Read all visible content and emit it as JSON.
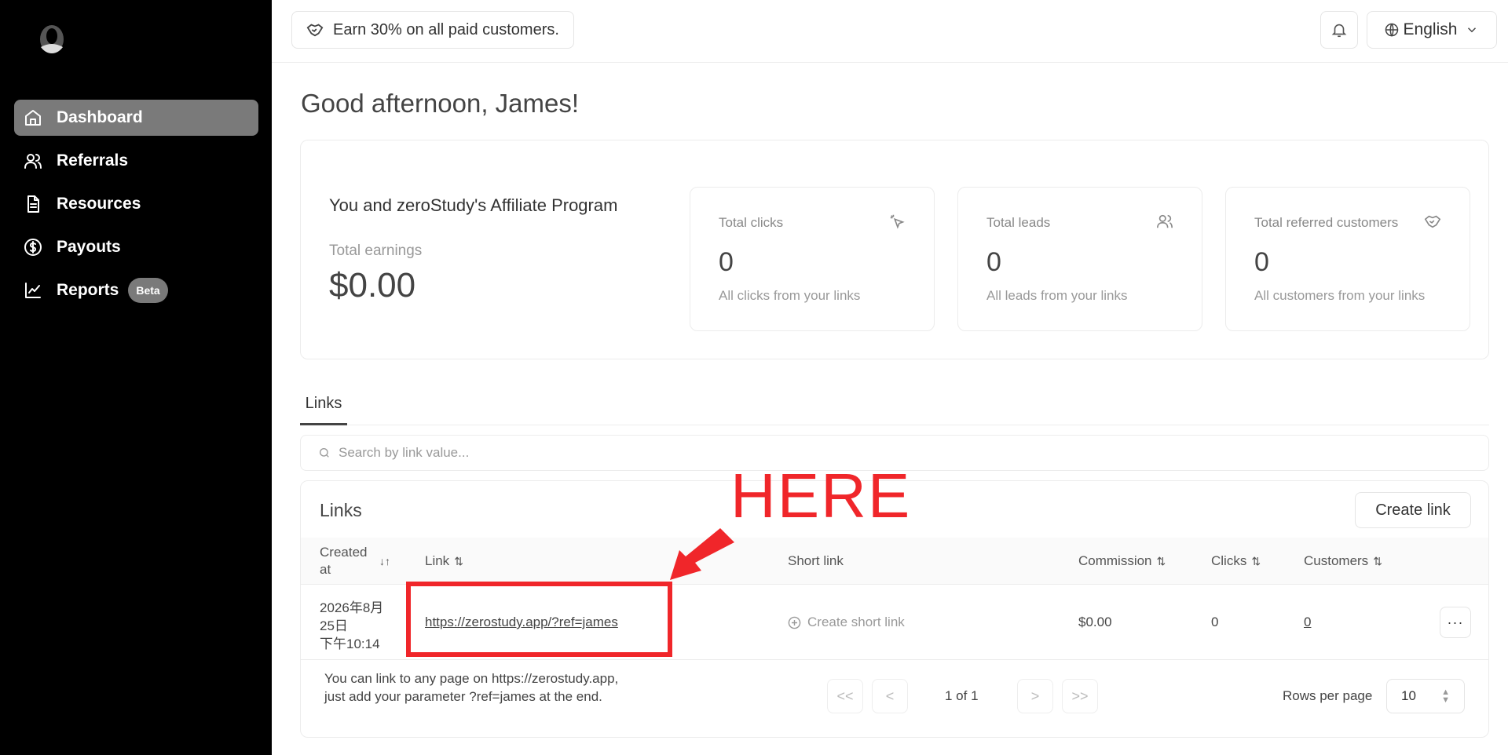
{
  "sidebar": {
    "items": [
      {
        "label": "Dashboard",
        "icon": "home-icon",
        "active": true
      },
      {
        "label": "Referrals",
        "icon": "users-icon"
      },
      {
        "label": "Resources",
        "icon": "document-icon"
      },
      {
        "label": "Payouts",
        "icon": "dollar-icon"
      },
      {
        "label": "Reports",
        "icon": "chart-icon",
        "badge": "Beta"
      }
    ]
  },
  "topbar": {
    "promo": "Earn 30% on all paid customers.",
    "language": "English"
  },
  "greeting": "Good afternoon, James!",
  "program": {
    "title": "You and zeroStudy's Affiliate Program",
    "earnings_label": "Total earnings",
    "earnings_value": "$0.00"
  },
  "stats": [
    {
      "label": "Total clicks",
      "value": "0",
      "sub": "All clicks from your links",
      "icon": "cursor-click-icon"
    },
    {
      "label": "Total leads",
      "value": "0",
      "sub": "All leads from your links",
      "icon": "users-icon"
    },
    {
      "label": "Total referred customers",
      "value": "0",
      "sub": "All customers from your links",
      "icon": "handshake-icon"
    }
  ],
  "tabs": [
    "Links"
  ],
  "search": {
    "placeholder": "Search by link value..."
  },
  "links": {
    "title": "Links",
    "create_button": "Create link",
    "columns": {
      "created": "Created at",
      "link": "Link",
      "short": "Short link",
      "commission": "Commission",
      "clicks": "Clicks",
      "customers": "Customers"
    },
    "rows": [
      {
        "created_line1": "2026年8月",
        "created_line2": "25日",
        "created_line3": "下午10:14",
        "link": "https://zerostudy.app/?ref=james",
        "short": "Create short link",
        "commission": "$0.00",
        "clicks": "0",
        "customers": "0",
        "more": "···"
      }
    ],
    "footer_note": "You can link to any page on https://zerostudy.app, just add your parameter ?ref=james at the end.",
    "pagination": {
      "first": "<<",
      "prev": "<",
      "page_text": "1 of 1",
      "next": ">",
      "last": ">>"
    },
    "rows_per_page_label": "Rows per page",
    "rows_per_page_value": "10"
  },
  "annotation": {
    "text": "HERE",
    "color": "#f0262a"
  }
}
